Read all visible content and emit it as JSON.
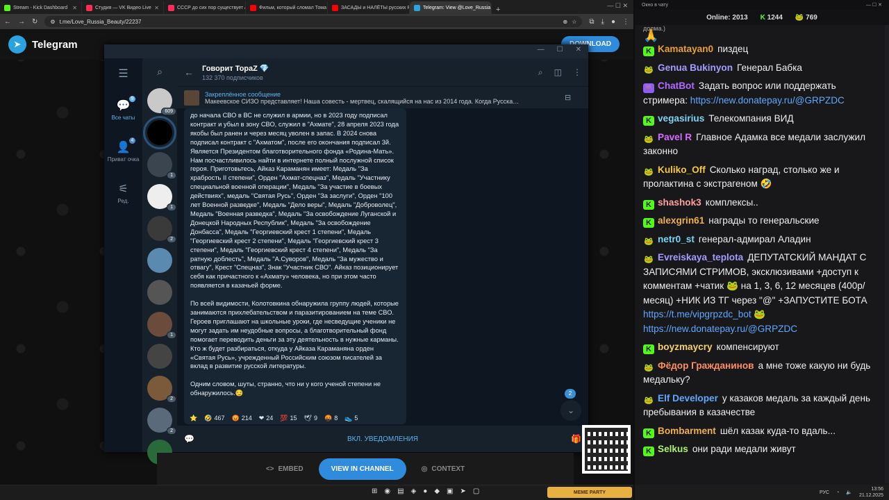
{
  "browser": {
    "tabs": [
      {
        "label": "Stream - Kick Dashboard",
        "color": "#53fc18"
      },
      {
        "label": "Студия — VK Видео Live",
        "color": "#ff2d55"
      },
      {
        "label": "СССР до сих пор существует / …",
        "color": "#ff2d55"
      },
      {
        "label": "Фильм, который сломал Тома…",
        "color": "#ff0000"
      },
      {
        "label": "ЗАСАДЫ и НАЛЁТЫ русских Р…",
        "color": "#ff0000"
      },
      {
        "label": "Telegram: View @Love_Russia…",
        "color": "#2aa3e0",
        "active": true
      }
    ],
    "url": "t.me/Love_Russia_Beauty/22237",
    "add_tab": "+"
  },
  "telegram_page": {
    "brand": "Telegram",
    "download": "DOWNLOAD"
  },
  "folders": [
    {
      "label": "Все чаты",
      "count": "9",
      "icon": "chats-icon",
      "active": true
    },
    {
      "label": "Приват очка",
      "count": "4",
      "icon": "private-icon"
    },
    {
      "label": "Ред.",
      "count": "",
      "icon": "edit-icon"
    }
  ],
  "chatlist_badges": [
    "609",
    "",
    "1",
    "1",
    "2",
    "",
    "",
    "1",
    "",
    "2",
    "2",
    ""
  ],
  "channel": {
    "title": "Говорит TopaZ 💎",
    "subscribers": "132 370 подписчиков",
    "pinned_label": "Закреплённое сообщение",
    "pinned_text": "Макеевское СИЗО представляет!  Наша совесть - мертвец, скалящийся на нас из 2014 года.  Когда Русска…"
  },
  "message": {
    "p1": "до начала СВО в ВС не служил в армии, но в 2023 году подписал контракт и убыл в зону СВО, служил в \"Ахмате\", 28 апреля 2023 года якобы был ранен и через месяц уволен в запас. В 2024 снова подписал контракт с \"Ахматом\", после его окончания подписал 3й. Является Президентом благотворительного фонда «Родина-Мать». Нам посчастливилось найти в интернете полный послужной список героя. Приготовьтесь, Айказ Караманян имеет: Медаль \"За храбрость II степени\", Орден \"Ахмат-спецназ\", Медаль \"Участнику специальной военной операции\", Медаль \"За участие в боевых действиях\", медаль \"Святая Русь\", Орден \"За заслуги\", Орден \"100 лет Военной разведке\", Медаль \"Дело веры\", Медаль \"Доброволец\", Медаль \"Военная разведка\", Медаль \"За освобождение Луганской и Донецкой Народных Республик\", Медаль \"За освобождение Донбасса\", Медаль \"Георгиевский крест 1 степени\", Медаль \"Георгиевский крест 2 степени\", Медаль \"Георгиевский крест 3 степени\", Медаль \"Георгиевский крест 4 степени\", Медаль \"За ратную доблесть\", Медаль \"А.Суворов\", Медаль \"За мужество и отвагу\", Крест \"Спецназ\", Знак \"Участник СВО\". Айказ позиционирует себя как причастного к «Ахмату» человека, но при этом часто появляется в казачьей форме.",
    "p2": "По всей видимости, Колотовкина обнаружила группу людей, которые занимаются прихлебательством и паразитированием на теме СВО. Героев приглашают на школьные уроки, где несведущие ученики не могут задать им неудобные вопросы, а благотворительный фонд помогает переводить деньги за эту деятельность в нужные карманы. Кто ж будет разбираться, откуда у Айказа Караманяна орден «Святая Русь», учрежденный Российским союзом писателей за вклад в развитие русской литературы.",
    "p3": "Одним словом, шуты, странно, что ни у кого ученой степени не обнаружилось.😏"
  },
  "reactions": [
    {
      "emoji": "⭐",
      "count": ""
    },
    {
      "emoji": "🤣",
      "count": "467"
    },
    {
      "emoji": "😡",
      "count": "214"
    },
    {
      "emoji": "❤",
      "count": "24"
    },
    {
      "emoji": "💯",
      "count": "15"
    },
    {
      "emoji": "🕊",
      "count": "9"
    },
    {
      "emoji": "🤬",
      "count": "8"
    },
    {
      "emoji": "👟",
      "count": "5"
    }
  ],
  "composer": {
    "notify": "ВКЛ. УВЕДОМЛЕНИЯ"
  },
  "scroll_count": "2",
  "embed_bar": {
    "embed": "EMBED",
    "view": "VIEW IN CHANNEL",
    "context": "CONTEXT"
  },
  "taskbar": {
    "meme": "MEME PARTY"
  },
  "stream_chat": {
    "window_title": "Окно в чату",
    "online_label": "Online:",
    "online": "2013",
    "kick_count": "1244",
    "pepe_count": "769",
    "top_fragment": "долма.)",
    "messages": [
      {
        "user": "Kamatayan0",
        "color": "#e8a035",
        "badge": "K",
        "text": "пиздец"
      },
      {
        "user": "Genua Bukinyon",
        "color": "#a59cff",
        "badge": "P",
        "text": "Генерал Бабка"
      },
      {
        "user": "ChatBot",
        "color": "#b36bff",
        "badge": "B",
        "text": "Задать вопрос или поддержать стримера: ",
        "link": "https://new.donatepay.ru/@GRPZDC"
      },
      {
        "user": "vegasirius",
        "color": "#7ed3f5",
        "badge": "K",
        "text": "Телекомпания ВИД"
      },
      {
        "user": "Pavel R",
        "color": "#d46cff",
        "badge": "P",
        "text": "Главное Адамка все медали заслужил законно"
      },
      {
        "user": "Kuliko_Off",
        "color": "#f5c842",
        "badge": "P",
        "text": "Сколько наград, столько же и пролактина с экстрагеном 🤣"
      },
      {
        "user": "shashok3",
        "color": "#ff9e9e",
        "badge": "K",
        "text": "комплексы.."
      },
      {
        "user": "alexgrin61",
        "color": "#f0b050",
        "badge": "K",
        "text": "награды то генеральские"
      },
      {
        "user": "netr0_st",
        "color": "#7ed3f5",
        "badge": "P",
        "text": "генерал-адмирал Аладин"
      },
      {
        "user": "Evreiskaya_teplota",
        "color": "#a59cff",
        "badge": "P",
        "text": "ДЕПУТАТСКИЙ МАНДАТ С ЗАПИСЯМИ СТРИМОВ, эксклюзивами +доступ к комментам +чатик 🐸 на 1, 3, 6, 12 месяцев (400р/месяц) +НИК ИЗ ТГ через \"@\" +ЗАПУСТИТЕ БОТА ",
        "link": "https://t.me/vipgrpzdc_bot 🐸 https://new.donatepay.ru/@GRPZDC"
      },
      {
        "user": "boyzmaycry",
        "color": "#f5d26b",
        "badge": "K",
        "text": "компенсируют"
      },
      {
        "user": "Фёдор Гражданинов",
        "color": "#ff8f5e",
        "badge": "P",
        "text": "а мне тоже какую ни будь медальку?"
      },
      {
        "user": "Elf Developer",
        "color": "#5fa8ff",
        "badge": "P",
        "text": "у казаков медаль за каждый день пребывания в казачестве"
      },
      {
        "user": "Bombarment",
        "color": "#f0b050",
        "badge": "K",
        "text": "шёл казак куда-то вдаль..."
      },
      {
        "user": "Selkus",
        "color": "#b0f070",
        "badge": "K",
        "text": "они ради медали живут"
      }
    ]
  },
  "system": {
    "lang": "РУС",
    "time": "13:56",
    "date": "21.12.2025"
  }
}
